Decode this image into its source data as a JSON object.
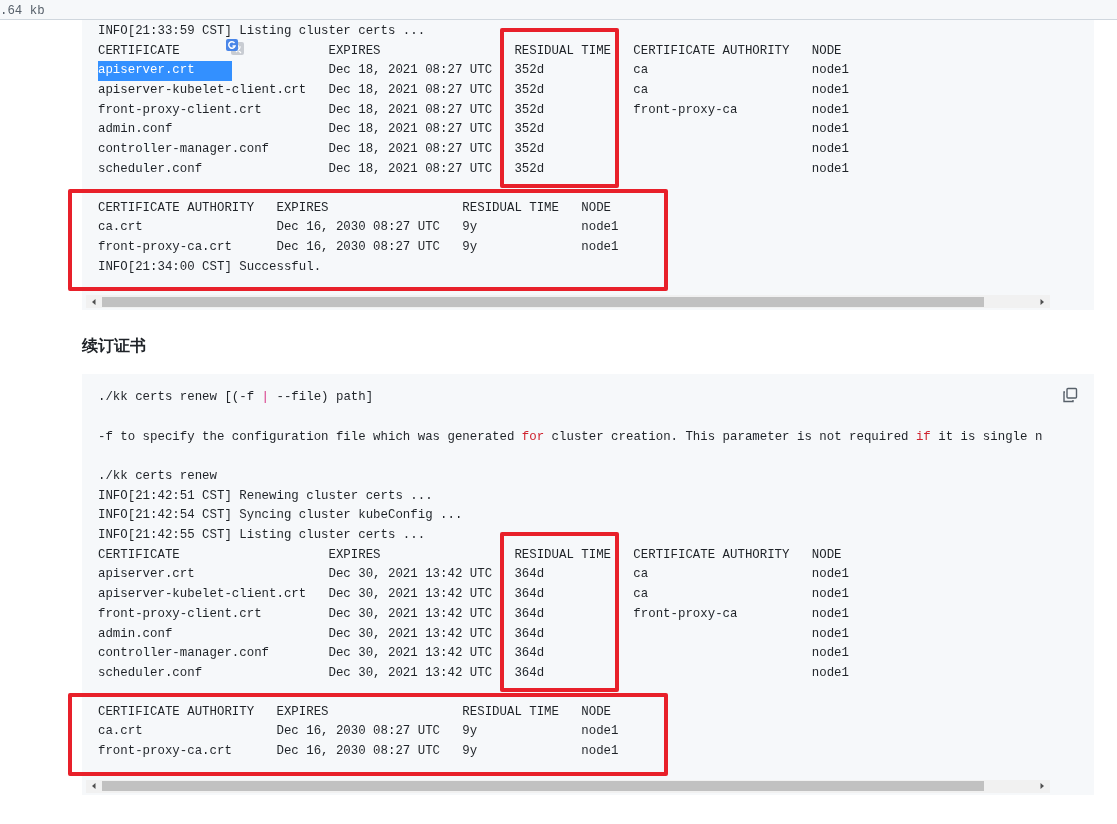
{
  "file_bar": {
    "size": ".64 kb"
  },
  "blocks": [
    {
      "copy_button": false,
      "parts": [
        {
          "framed": false,
          "items": [
            {
              "kind": "line",
              "text": "INFO[21:33:59 CST] Listing cluster certs ..."
            },
            {
              "kind": "table",
              "columns": [
                {
                  "title": "CERTIFICATE",
                  "highlighted": false
                },
                {
                  "title": "EXPIRES",
                  "highlighted": false
                },
                {
                  "title": "RESIDUAL TIME",
                  "highlighted": true
                },
                {
                  "title": "CERTIFICATE AUTHORITY",
                  "highlighted": false
                },
                {
                  "title": "NODE",
                  "highlighted": false
                }
              ],
              "rows": [
                {
                  "selected": true,
                  "cells": [
                    "apiserver.crt",
                    "Dec 18, 2021 08:27 UTC",
                    "352d",
                    "ca",
                    "node1"
                  ]
                },
                {
                  "selected": false,
                  "cells": [
                    "apiserver-kubelet-client.crt",
                    "Dec 18, 2021 08:27 UTC",
                    "352d",
                    "ca",
                    "node1"
                  ]
                },
                {
                  "selected": false,
                  "cells": [
                    "front-proxy-client.crt",
                    "Dec 18, 2021 08:27 UTC",
                    "352d",
                    "front-proxy-ca",
                    "node1"
                  ]
                },
                {
                  "selected": false,
                  "cells": [
                    "admin.conf",
                    "Dec 18, 2021 08:27 UTC",
                    "352d",
                    "",
                    "node1"
                  ]
                },
                {
                  "selected": false,
                  "cells": [
                    "controller-manager.conf",
                    "Dec 18, 2021 08:27 UTC",
                    "352d",
                    "",
                    "node1"
                  ]
                },
                {
                  "selected": false,
                  "cells": [
                    "scheduler.conf",
                    "Dec 18, 2021 08:27 UTC",
                    "352d",
                    "",
                    "node1"
                  ]
                }
              ]
            }
          ]
        },
        {
          "framed": true,
          "items": [
            {
              "kind": "table",
              "columns": [
                {
                  "title": "CERTIFICATE AUTHORITY",
                  "highlighted": false
                },
                {
                  "title": "EXPIRES",
                  "highlighted": false
                },
                {
                  "title": "RESIDUAL TIME",
                  "highlighted": false
                },
                {
                  "title": "NODE",
                  "highlighted": false
                }
              ],
              "rows": [
                {
                  "selected": false,
                  "cells": [
                    "ca.crt",
                    "Dec 16, 2030 08:27 UTC",
                    "9y",
                    "node1"
                  ]
                },
                {
                  "selected": false,
                  "cells": [
                    "front-proxy-ca.crt",
                    "Dec 16, 2030 08:27 UTC",
                    "9y",
                    "node1"
                  ]
                }
              ]
            },
            {
              "kind": "line",
              "text": "INFO[21:34:00 CST] Successful."
            }
          ]
        }
      ]
    },
    {
      "heading": "续订证书",
      "copy_button": true,
      "parts": [
        {
          "framed": false,
          "items": [
            {
              "kind": "line",
              "segments": [
                {
                  "kind": "plain",
                  "text": "./kk certs renew [(-f "
                },
                {
                  "kind": "operator",
                  "text": "|"
                },
                {
                  "kind": "plain",
                  "text": " --file) path]"
                }
              ]
            }
          ]
        },
        {
          "framed": false,
          "items": [
            {
              "kind": "line",
              "segments": [
                {
                  "kind": "plain",
                  "text": "-f to specify the configuration file which was generated "
                },
                {
                  "kind": "keyword",
                  "text": "for"
                },
                {
                  "kind": "plain",
                  "text": " cluster creation. This parameter is not required "
                },
                {
                  "kind": "keyword",
                  "text": "if"
                },
                {
                  "kind": "plain",
                  "text": " it is single n"
                }
              ]
            }
          ]
        },
        {
          "framed": false,
          "items": [
            {
              "kind": "line",
              "text": "./kk certs renew"
            },
            {
              "kind": "line",
              "text": "INFO[21:42:51 CST] Renewing cluster certs ..."
            },
            {
              "kind": "line",
              "text": "INFO[21:42:54 CST] Syncing cluster kubeConfig ..."
            },
            {
              "kind": "line",
              "text": "INFO[21:42:55 CST] Listing cluster certs ..."
            },
            {
              "kind": "table",
              "columns": [
                {
                  "title": "CERTIFICATE",
                  "highlighted": false
                },
                {
                  "title": "EXPIRES",
                  "highlighted": false
                },
                {
                  "title": "RESIDUAL TIME",
                  "highlighted": true
                },
                {
                  "title": "CERTIFICATE AUTHORITY",
                  "highlighted": false
                },
                {
                  "title": "NODE",
                  "highlighted": false
                }
              ],
              "rows": [
                {
                  "selected": false,
                  "cells": [
                    "apiserver.crt",
                    "Dec 30, 2021 13:42 UTC",
                    "364d",
                    "ca",
                    "node1"
                  ]
                },
                {
                  "selected": false,
                  "cells": [
                    "apiserver-kubelet-client.crt",
                    "Dec 30, 2021 13:42 UTC",
                    "364d",
                    "ca",
                    "node1"
                  ]
                },
                {
                  "selected": false,
                  "cells": [
                    "front-proxy-client.crt",
                    "Dec 30, 2021 13:42 UTC",
                    "364d",
                    "front-proxy-ca",
                    "node1"
                  ]
                },
                {
                  "selected": false,
                  "cells": [
                    "admin.conf",
                    "Dec 30, 2021 13:42 UTC",
                    "364d",
                    "",
                    "node1"
                  ]
                },
                {
                  "selected": false,
                  "cells": [
                    "controller-manager.conf",
                    "Dec 30, 2021 13:42 UTC",
                    "364d",
                    "",
                    "node1"
                  ]
                },
                {
                  "selected": false,
                  "cells": [
                    "scheduler.conf",
                    "Dec 30, 2021 13:42 UTC",
                    "364d",
                    "",
                    "node1"
                  ]
                }
              ]
            }
          ]
        },
        {
          "framed": true,
          "items": [
            {
              "kind": "table",
              "columns": [
                {
                  "title": "CERTIFICATE AUTHORITY",
                  "highlighted": false
                },
                {
                  "title": "EXPIRES",
                  "highlighted": false
                },
                {
                  "title": "RESIDUAL TIME",
                  "highlighted": false
                },
                {
                  "title": "NODE",
                  "highlighted": false
                }
              ],
              "rows": [
                {
                  "selected": false,
                  "cells": [
                    "ca.crt",
                    "Dec 16, 2030 08:27 UTC",
                    "9y",
                    "node1"
                  ]
                },
                {
                  "selected": false,
                  "cells": [
                    "front-proxy-ca.crt",
                    "Dec 16, 2030 08:27 UTC",
                    "9y",
                    "node1"
                  ]
                }
              ]
            }
          ]
        }
      ]
    }
  ]
}
